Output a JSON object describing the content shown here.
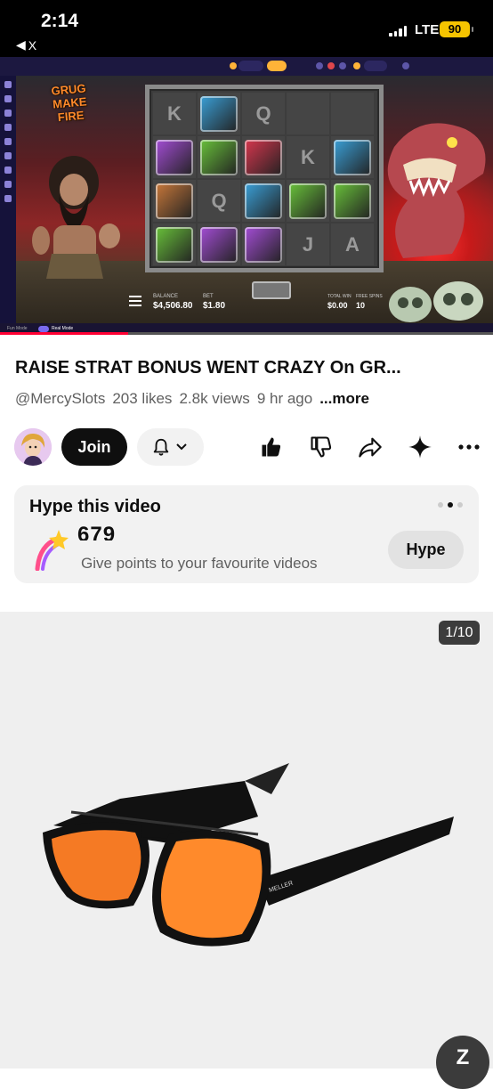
{
  "status_bar": {
    "time": "2:14",
    "back_label": "X",
    "network": "LTE",
    "battery": "90"
  },
  "player": {
    "game_logo": "GRUG MAKE FIRE",
    "hud": {
      "balance_label": "BALANCE",
      "balance": "$4,506.80",
      "bet_label": "BET",
      "bet": "$1.80",
      "total_win_label": "TOTAL WIN",
      "total_win": "$0.00",
      "free_spins_label": "FREE SPINS",
      "free_spins": "10"
    },
    "reels": [
      [
        "K",
        "blue",
        "Q",
        "",
        ""
      ],
      [
        "purple",
        "green",
        "red",
        "K",
        "blue"
      ],
      [
        "orange",
        "Q",
        "blue",
        "green",
        "green"
      ],
      [
        "green",
        "purple",
        "purple",
        "J",
        "A"
      ]
    ],
    "bottom": {
      "fun_mode": "Fun Mode",
      "real_mode": "Real Mode"
    },
    "progress_fraction": 0.26,
    "colors": {
      "progress": "#ff0033"
    }
  },
  "video": {
    "title": "RAISE STRAT BONUS WENT CRAZY On GR...",
    "channel": "@MercySlots",
    "likes": "203 likes",
    "views": "2.8k views",
    "age": "9 hr ago",
    "more": "...more"
  },
  "actions": {
    "join": "Join"
  },
  "hype": {
    "title": "Hype this video",
    "count": "679",
    "subtitle": "Give points to your favourite videos",
    "button": "Hype"
  },
  "ad": {
    "counter": "1/10",
    "brand": "MELLER",
    "corner": "Z"
  }
}
